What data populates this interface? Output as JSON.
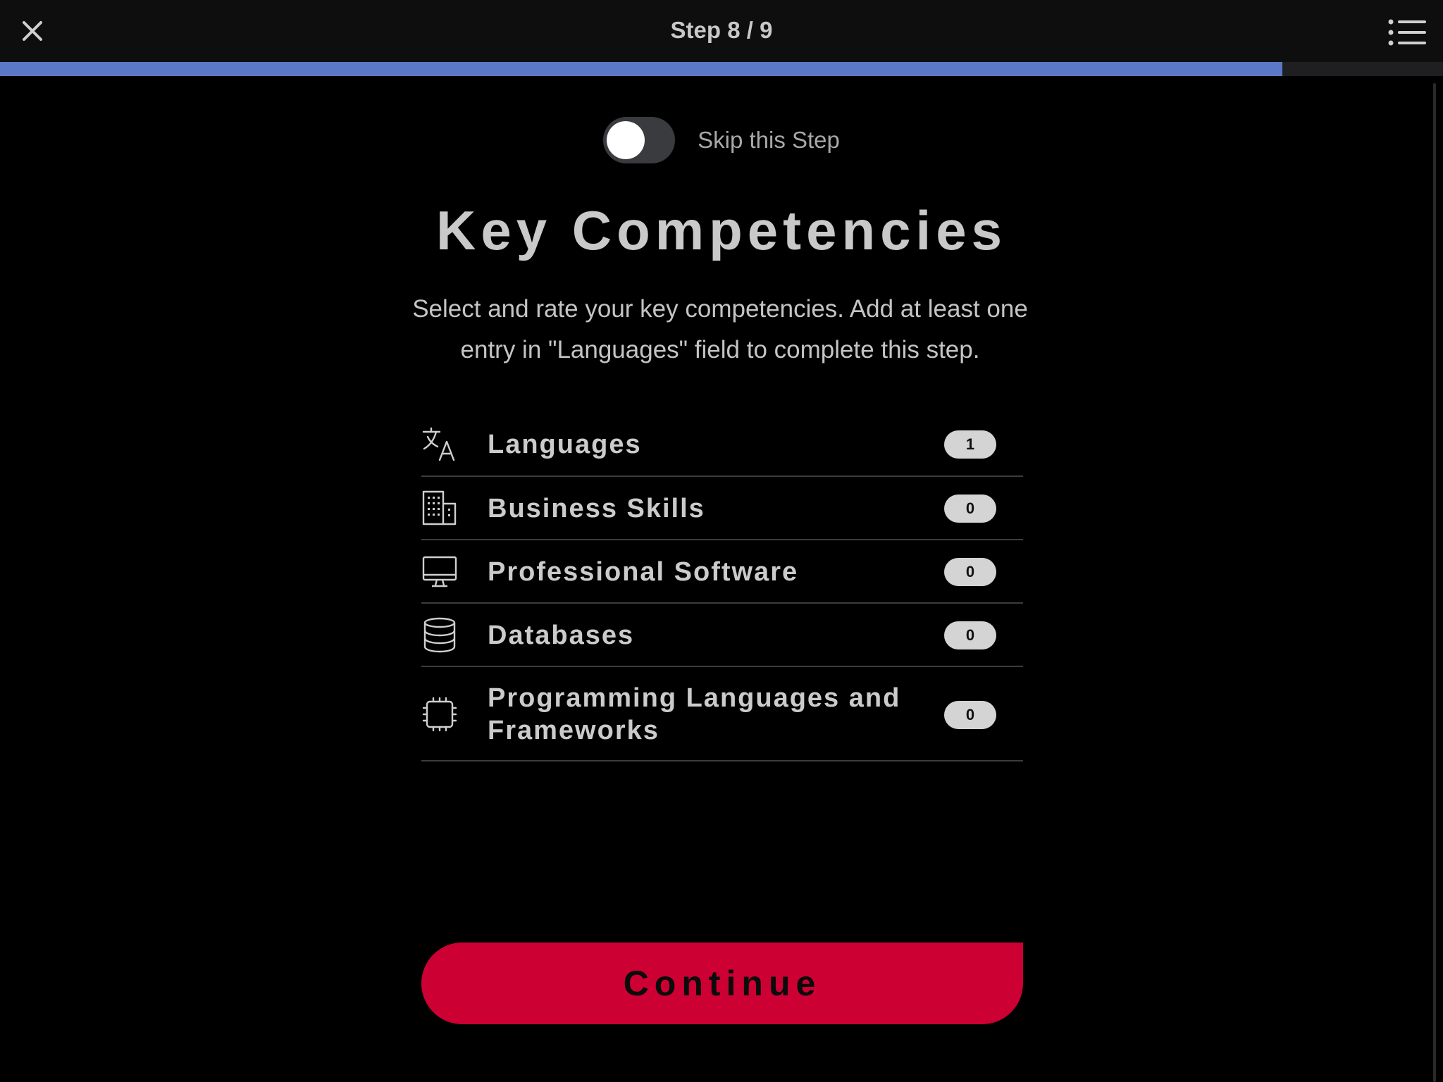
{
  "header": {
    "step_label": "Step 8 / 9",
    "progress_fraction": 0.8889,
    "icons": {
      "close": "close-icon",
      "menu": "list-menu-icon"
    }
  },
  "skip": {
    "label": "Skip this Step",
    "enabled": false
  },
  "main": {
    "title": "Key Competencies",
    "description": "Select and rate your key competencies. Add at least one entry in \"Languages\" field to complete this step."
  },
  "competencies": [
    {
      "label": "Languages",
      "count": "1",
      "icon": "translate-icon"
    },
    {
      "label": "Business Skills",
      "count": "0",
      "icon": "building-icon"
    },
    {
      "label": "Professional Software",
      "count": "0",
      "icon": "monitor-icon"
    },
    {
      "label": "Databases",
      "count": "0",
      "icon": "database-icon"
    },
    {
      "label": "Programming Languages and Frameworks",
      "count": "0",
      "icon": "chip-icon"
    }
  ],
  "actions": {
    "continue_label": "Continue"
  },
  "colors": {
    "background": "#000000",
    "topbar": "#0e0e0e",
    "progress": "#5b78c8",
    "accent_button": "#cc0033",
    "badge": "#d4d4d4"
  }
}
